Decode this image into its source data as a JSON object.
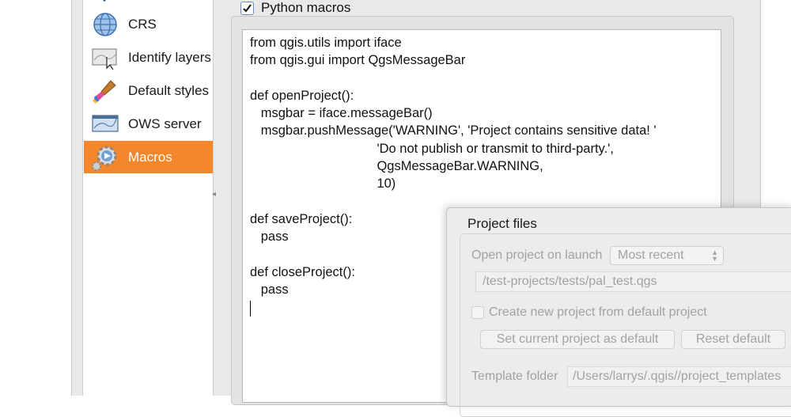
{
  "sidebar": {
    "items": [
      {
        "label": "CRS",
        "icon": "globe-icon"
      },
      {
        "label": "Identify layers",
        "icon": "identify-map-icon"
      },
      {
        "label": "Default styles",
        "icon": "paintbrush-icon"
      },
      {
        "label": "OWS server",
        "icon": "ows-map-icon"
      },
      {
        "label": "Macros",
        "icon": "macros-gear-icon",
        "active": true
      }
    ],
    "active_color": "#f4862b"
  },
  "macros": {
    "checkbox_label": "Python macros",
    "checked": true,
    "code_lines": [
      "from qgis.utils import iface",
      "from qgis.gui import QgsMessageBar",
      "",
      "def openProject():",
      "   msgbar = iface.messageBar()",
      "   msgbar.pushMessage('WARNING', 'Project contains sensitive data! '",
      "                                   'Do not publish or transmit to third-party.',",
      "                                   QgsMessageBar.WARNING,",
      "                                   10)",
      "",
      "def saveProject():",
      "   pass",
      "",
      "def closeProject():",
      "   pass"
    ]
  },
  "project_files": {
    "title": "Project files",
    "open_label": "Open project on launch",
    "open_value": "Most recent",
    "path_value": "/test-projects/tests/pal_test.qgs",
    "create_label": "Create new project from default project",
    "set_default_button": "Set current project as default",
    "reset_default_button": "Reset default",
    "template_label": "Template folder",
    "template_value": "/Users/larrys/.qgis//project_templates"
  }
}
